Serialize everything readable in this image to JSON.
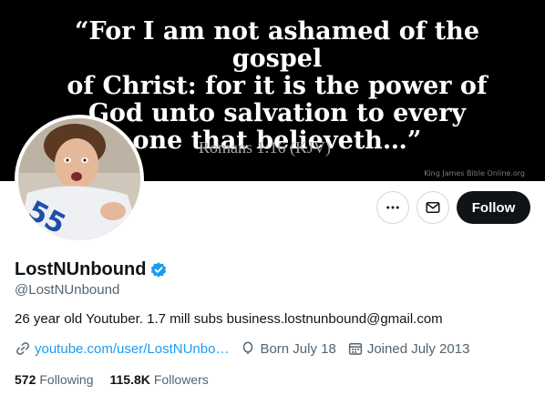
{
  "banner": {
    "quote_line1": "“For I am not ashamed of the gospel",
    "quote_line2": "of Christ: for it is the power of",
    "quote_line3": "God unto salvation to every",
    "quote_line4": "one that believeth…”",
    "reference": "Romans 1:16 (KJV)",
    "credit": "King James Bible Online.org"
  },
  "actions": {
    "more_icon": "more-horizontal-icon",
    "message_icon": "envelope-icon",
    "follow_label": "Follow"
  },
  "profile": {
    "display_name": "LostNUnbound",
    "verified_icon": "verified-badge-icon",
    "verified_color": "#1d9bf0",
    "handle": "@LostNUnbound",
    "bio": "26 year old Youtuber. 1.7 mill subs business.lostnunbound@gmail.com",
    "website": "youtube.com/user/LostNUnbo…",
    "birthday": "Born July 18",
    "joined": "Joined July 2013"
  },
  "stats": {
    "following_count": "572",
    "following_label": "Following",
    "followers_count": "115.8K",
    "followers_label": "Followers"
  }
}
